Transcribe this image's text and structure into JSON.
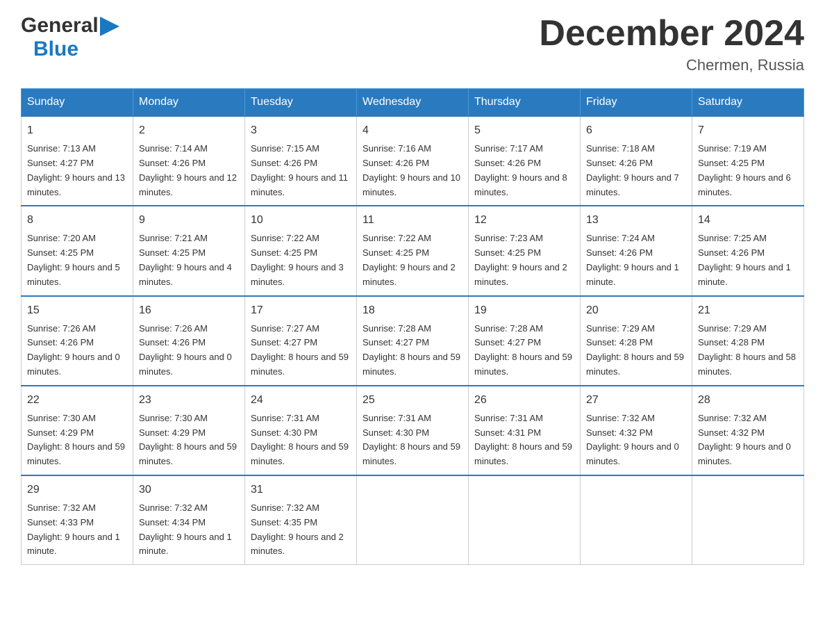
{
  "header": {
    "logo_general": "General",
    "logo_blue": "Blue",
    "month_title": "December 2024",
    "location": "Chermen, Russia"
  },
  "weekdays": [
    "Sunday",
    "Monday",
    "Tuesday",
    "Wednesday",
    "Thursday",
    "Friday",
    "Saturday"
  ],
  "weeks": [
    [
      {
        "day": "1",
        "sunrise": "7:13 AM",
        "sunset": "4:27 PM",
        "daylight": "9 hours and 13 minutes."
      },
      {
        "day": "2",
        "sunrise": "7:14 AM",
        "sunset": "4:26 PM",
        "daylight": "9 hours and 12 minutes."
      },
      {
        "day": "3",
        "sunrise": "7:15 AM",
        "sunset": "4:26 PM",
        "daylight": "9 hours and 11 minutes."
      },
      {
        "day": "4",
        "sunrise": "7:16 AM",
        "sunset": "4:26 PM",
        "daylight": "9 hours and 10 minutes."
      },
      {
        "day": "5",
        "sunrise": "7:17 AM",
        "sunset": "4:26 PM",
        "daylight": "9 hours and 8 minutes."
      },
      {
        "day": "6",
        "sunrise": "7:18 AM",
        "sunset": "4:26 PM",
        "daylight": "9 hours and 7 minutes."
      },
      {
        "day": "7",
        "sunrise": "7:19 AM",
        "sunset": "4:25 PM",
        "daylight": "9 hours and 6 minutes."
      }
    ],
    [
      {
        "day": "8",
        "sunrise": "7:20 AM",
        "sunset": "4:25 PM",
        "daylight": "9 hours and 5 minutes."
      },
      {
        "day": "9",
        "sunrise": "7:21 AM",
        "sunset": "4:25 PM",
        "daylight": "9 hours and 4 minutes."
      },
      {
        "day": "10",
        "sunrise": "7:22 AM",
        "sunset": "4:25 PM",
        "daylight": "9 hours and 3 minutes."
      },
      {
        "day": "11",
        "sunrise": "7:22 AM",
        "sunset": "4:25 PM",
        "daylight": "9 hours and 2 minutes."
      },
      {
        "day": "12",
        "sunrise": "7:23 AM",
        "sunset": "4:25 PM",
        "daylight": "9 hours and 2 minutes."
      },
      {
        "day": "13",
        "sunrise": "7:24 AM",
        "sunset": "4:26 PM",
        "daylight": "9 hours and 1 minute."
      },
      {
        "day": "14",
        "sunrise": "7:25 AM",
        "sunset": "4:26 PM",
        "daylight": "9 hours and 1 minute."
      }
    ],
    [
      {
        "day": "15",
        "sunrise": "7:26 AM",
        "sunset": "4:26 PM",
        "daylight": "9 hours and 0 minutes."
      },
      {
        "day": "16",
        "sunrise": "7:26 AM",
        "sunset": "4:26 PM",
        "daylight": "9 hours and 0 minutes."
      },
      {
        "day": "17",
        "sunrise": "7:27 AM",
        "sunset": "4:27 PM",
        "daylight": "8 hours and 59 minutes."
      },
      {
        "day": "18",
        "sunrise": "7:28 AM",
        "sunset": "4:27 PM",
        "daylight": "8 hours and 59 minutes."
      },
      {
        "day": "19",
        "sunrise": "7:28 AM",
        "sunset": "4:27 PM",
        "daylight": "8 hours and 59 minutes."
      },
      {
        "day": "20",
        "sunrise": "7:29 AM",
        "sunset": "4:28 PM",
        "daylight": "8 hours and 59 minutes."
      },
      {
        "day": "21",
        "sunrise": "7:29 AM",
        "sunset": "4:28 PM",
        "daylight": "8 hours and 58 minutes."
      }
    ],
    [
      {
        "day": "22",
        "sunrise": "7:30 AM",
        "sunset": "4:29 PM",
        "daylight": "8 hours and 59 minutes."
      },
      {
        "day": "23",
        "sunrise": "7:30 AM",
        "sunset": "4:29 PM",
        "daylight": "8 hours and 59 minutes."
      },
      {
        "day": "24",
        "sunrise": "7:31 AM",
        "sunset": "4:30 PM",
        "daylight": "8 hours and 59 minutes."
      },
      {
        "day": "25",
        "sunrise": "7:31 AM",
        "sunset": "4:30 PM",
        "daylight": "8 hours and 59 minutes."
      },
      {
        "day": "26",
        "sunrise": "7:31 AM",
        "sunset": "4:31 PM",
        "daylight": "8 hours and 59 minutes."
      },
      {
        "day": "27",
        "sunrise": "7:32 AM",
        "sunset": "4:32 PM",
        "daylight": "9 hours and 0 minutes."
      },
      {
        "day": "28",
        "sunrise": "7:32 AM",
        "sunset": "4:32 PM",
        "daylight": "9 hours and 0 minutes."
      }
    ],
    [
      {
        "day": "29",
        "sunrise": "7:32 AM",
        "sunset": "4:33 PM",
        "daylight": "9 hours and 1 minute."
      },
      {
        "day": "30",
        "sunrise": "7:32 AM",
        "sunset": "4:34 PM",
        "daylight": "9 hours and 1 minute."
      },
      {
        "day": "31",
        "sunrise": "7:32 AM",
        "sunset": "4:35 PM",
        "daylight": "9 hours and 2 minutes."
      },
      null,
      null,
      null,
      null
    ]
  ],
  "labels": {
    "sunrise": "Sunrise:",
    "sunset": "Sunset:",
    "daylight": "Daylight:"
  }
}
